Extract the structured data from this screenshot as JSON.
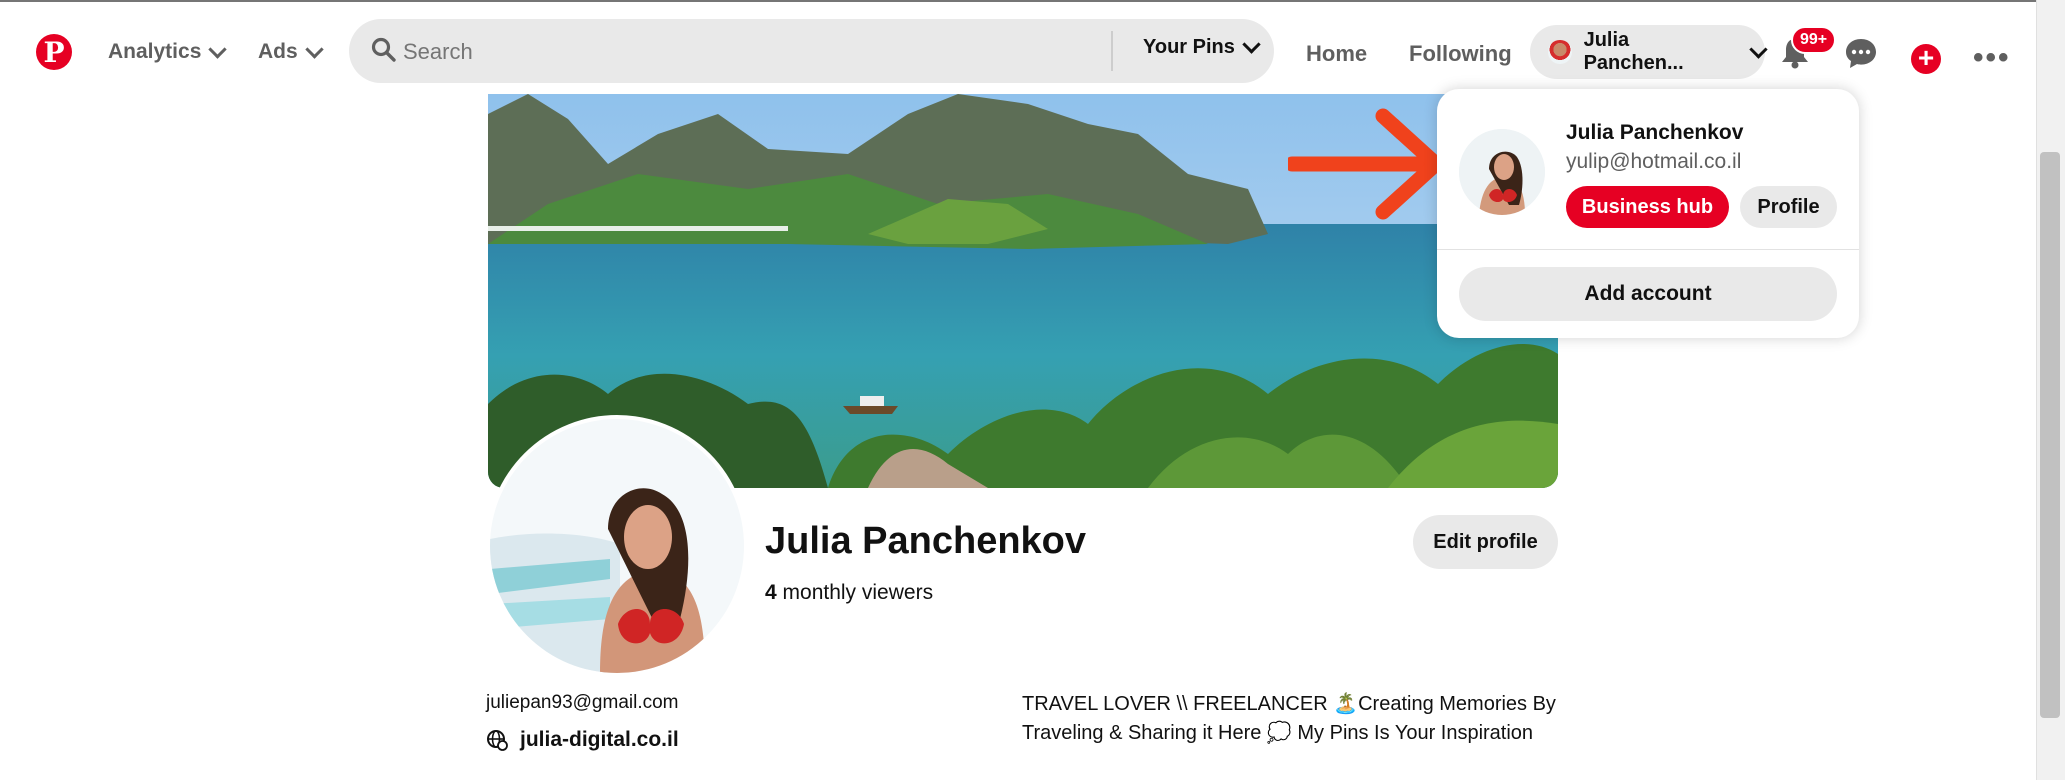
{
  "header": {
    "logo": "P",
    "nav_analytics": "Analytics",
    "nav_ads": "Ads",
    "search_placeholder": "Search",
    "your_pins": "Your Pins",
    "home": "Home",
    "following": "Following",
    "account_name": "Julia Panchen...",
    "notification_count": "99+"
  },
  "profile": {
    "name": "Julia Panchenkov",
    "viewers_count": "4",
    "viewers_label": " monthly viewers",
    "edit_label": "Edit profile",
    "email": "juliepan93@gmail.com",
    "website": "julia-digital.co.il",
    "bio": "TRAVEL LOVER \\\\ FREELANCER 🏝️Creating Memories By Traveling & Sharing it Here 💭 My Pins Is Your Inspiration"
  },
  "account_menu": {
    "name": "Julia Panchenkov",
    "email": "yulip@hotmail.co.il",
    "business_hub_label": "Business hub",
    "profile_label": "Profile",
    "add_account_label": "Add account"
  },
  "colors": {
    "brand": "#e60023",
    "pill_bg": "#e9e9e9",
    "annotation_arrow": "#f0421c"
  }
}
